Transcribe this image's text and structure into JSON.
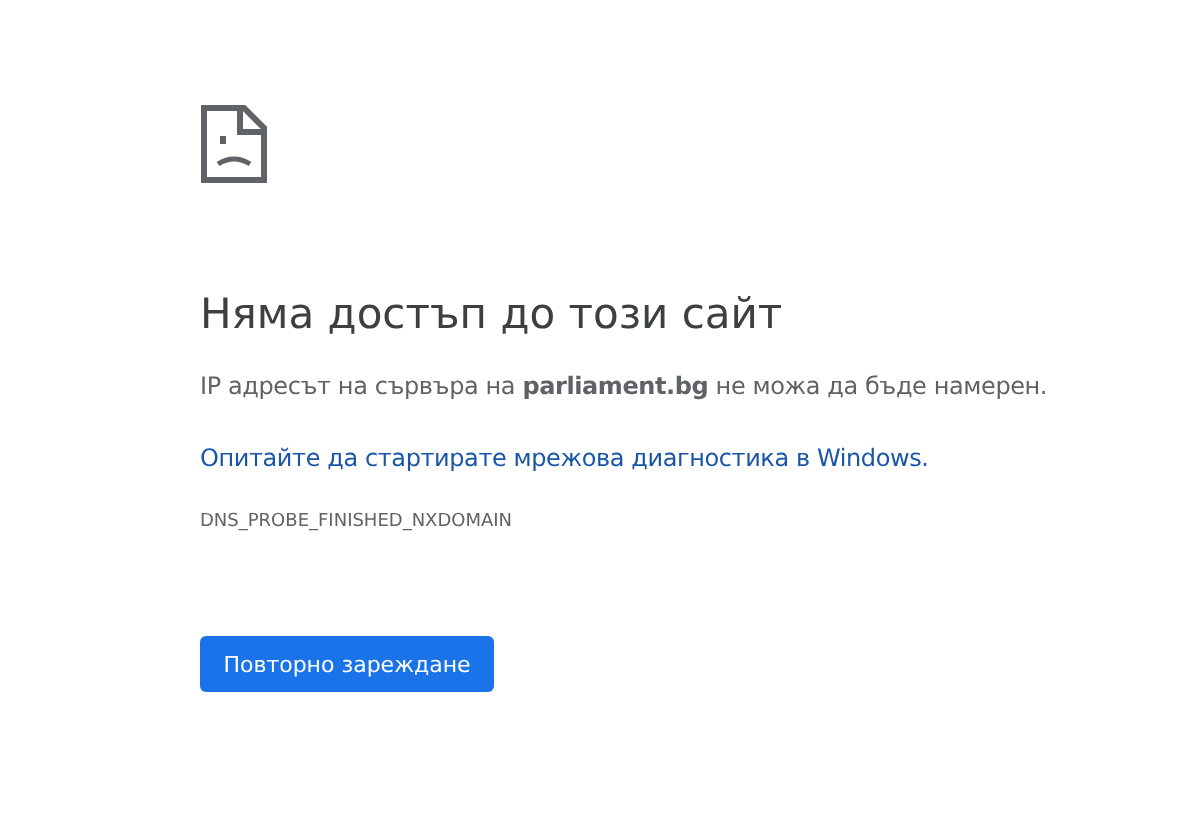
{
  "heading": "Няма достъп до този сайт",
  "message": "IP адресът на сървъра на **parliament.bg** не можа да бъде намерен.",
  "suggestion_link": "Опитайте да стартирате мрежова диагностика в Windows.",
  "error_code": "DNS_PROBE_FINISHED_NXDOMAIN",
  "reload_button": "Повторно зареждане"
}
